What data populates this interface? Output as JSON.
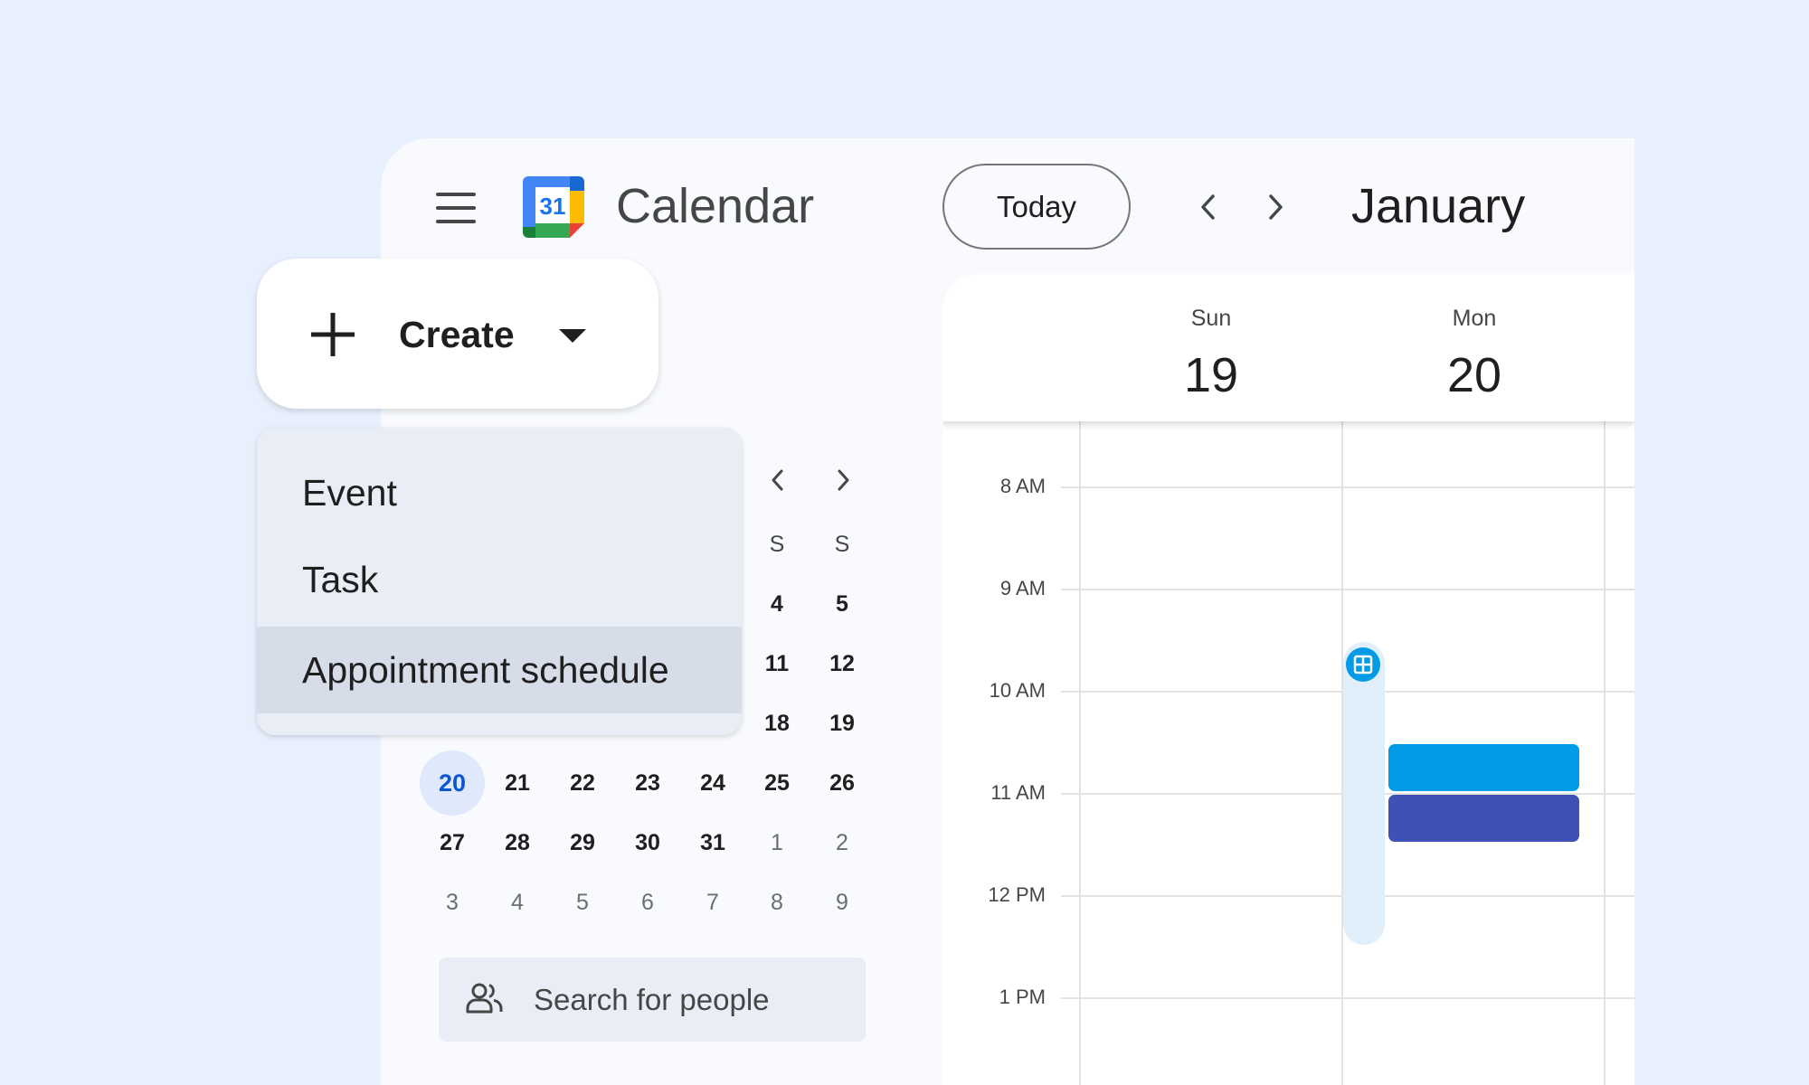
{
  "header": {
    "app_title": "Calendar",
    "logo_number": "31",
    "today_label": "Today",
    "month_title": "January",
    "icons": {
      "menu": "hamburger-menu-icon",
      "prev": "chevron-left-icon",
      "next": "chevron-right-icon"
    }
  },
  "create": {
    "label": "Create",
    "icons": {
      "plus": "plus-icon",
      "caret": "caret-down-icon"
    },
    "menu": {
      "items": [
        {
          "label": "Event",
          "active": false
        },
        {
          "label": "Task",
          "active": false
        },
        {
          "label": "Appointment schedule",
          "active": true
        }
      ]
    }
  },
  "mini_calendar": {
    "dow_visible": [
      "S",
      "S"
    ],
    "partial_rows": [
      [
        "4",
        "5"
      ],
      [
        "11",
        "12"
      ],
      [
        "18",
        "19"
      ]
    ],
    "full_rows": [
      [
        "20",
        "21",
        "22",
        "23",
        "24",
        "25",
        "26"
      ],
      [
        "27",
        "28",
        "29",
        "30",
        "31",
        "1",
        "2"
      ],
      [
        "3",
        "4",
        "5",
        "6",
        "7",
        "8",
        "9"
      ]
    ],
    "today": "20"
  },
  "search_people": {
    "placeholder": "Search for people",
    "icon": "people-icon"
  },
  "week_view": {
    "days": [
      {
        "dow": "Sun",
        "num": "19"
      },
      {
        "dow": "Mon",
        "num": "20"
      }
    ],
    "times": [
      "8 AM",
      "9 AM",
      "10 AM",
      "11 AM",
      "12 PM",
      "1 PM"
    ],
    "appointment_slot_icon": "grid-icon",
    "events": [
      {
        "color": "#039be5"
      },
      {
        "color": "#3f51b5"
      }
    ]
  },
  "colors": {
    "background": "#e8effd",
    "accent": "#0b57d0",
    "logo_blue": "#4285f4",
    "logo_green": "#34a853",
    "logo_yellow": "#fbbc04",
    "logo_red": "#ea4335"
  }
}
